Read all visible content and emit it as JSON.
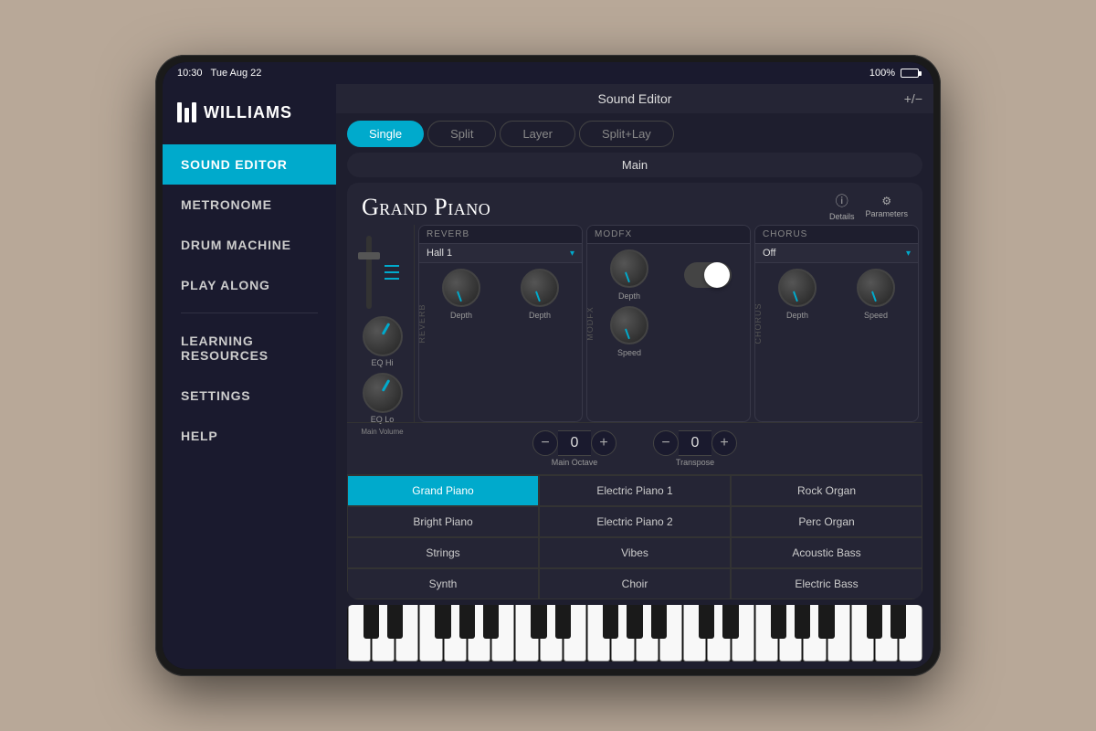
{
  "statusBar": {
    "time": "10:30",
    "date": "Tue Aug 22",
    "battery": "100%"
  },
  "header": {
    "title": "Sound Editor",
    "plusMinus": "+/−"
  },
  "tabs": [
    {
      "label": "Single",
      "active": true
    },
    {
      "label": "Split",
      "active": false
    },
    {
      "label": "Layer",
      "active": false
    },
    {
      "label": "Split+Lay",
      "active": false
    }
  ],
  "mainTab": "Main",
  "sidebar": {
    "logo": "WILLIAMS",
    "items": [
      {
        "label": "Sound Editor",
        "active": true
      },
      {
        "label": "Metronome",
        "active": false
      },
      {
        "label": "Drum Machine",
        "active": false
      },
      {
        "label": "Play Along",
        "active": false
      },
      {
        "label": "Learning Resources",
        "active": false
      },
      {
        "label": "Settings",
        "active": false
      },
      {
        "label": "Help",
        "active": false
      }
    ]
  },
  "soundEditor": {
    "instrumentTitle": "Grand Piano",
    "details": "Details",
    "parameters": "Parameters",
    "reverb": {
      "label": "Reverb",
      "selected": "Hall 1",
      "knobs": [
        {
          "label": "Depth"
        },
        {
          "label": "Depth"
        }
      ]
    },
    "modFX": {
      "label": "ModFX",
      "knobs": [
        {
          "label": "Depth"
        },
        {
          "label": "Speed"
        }
      ]
    },
    "chorus": {
      "label": "Chorus",
      "selected": "Off",
      "knobs": [
        {
          "label": "Depth"
        },
        {
          "label": "Speed"
        }
      ]
    },
    "volume": {
      "label": "Main Volume"
    },
    "eq": {
      "hiLabel": "EQ Hi",
      "loLabel": "EQ Lo"
    },
    "octave": {
      "label": "Main Octave",
      "value": "0"
    },
    "transpose": {
      "label": "Transpose",
      "value": "0"
    },
    "sounds": [
      {
        "name": "Grand Piano",
        "active": true
      },
      {
        "name": "Electric Piano 1",
        "active": false
      },
      {
        "name": "Rock Organ",
        "active": false
      },
      {
        "name": "Bright Piano",
        "active": false
      },
      {
        "name": "Electric Piano 2",
        "active": false
      },
      {
        "name": "Perc Organ",
        "active": false
      },
      {
        "name": "Strings",
        "active": false
      },
      {
        "name": "Vibes",
        "active": false
      },
      {
        "name": "Acoustic Bass",
        "active": false
      },
      {
        "name": "Synth",
        "active": false
      },
      {
        "name": "Choir",
        "active": false
      },
      {
        "name": "Electric Bass",
        "active": false
      }
    ]
  },
  "icons": {
    "minus": "−",
    "plus": "+",
    "chevronDown": "▾",
    "info": "ⓘ",
    "sliders": "⚙"
  }
}
